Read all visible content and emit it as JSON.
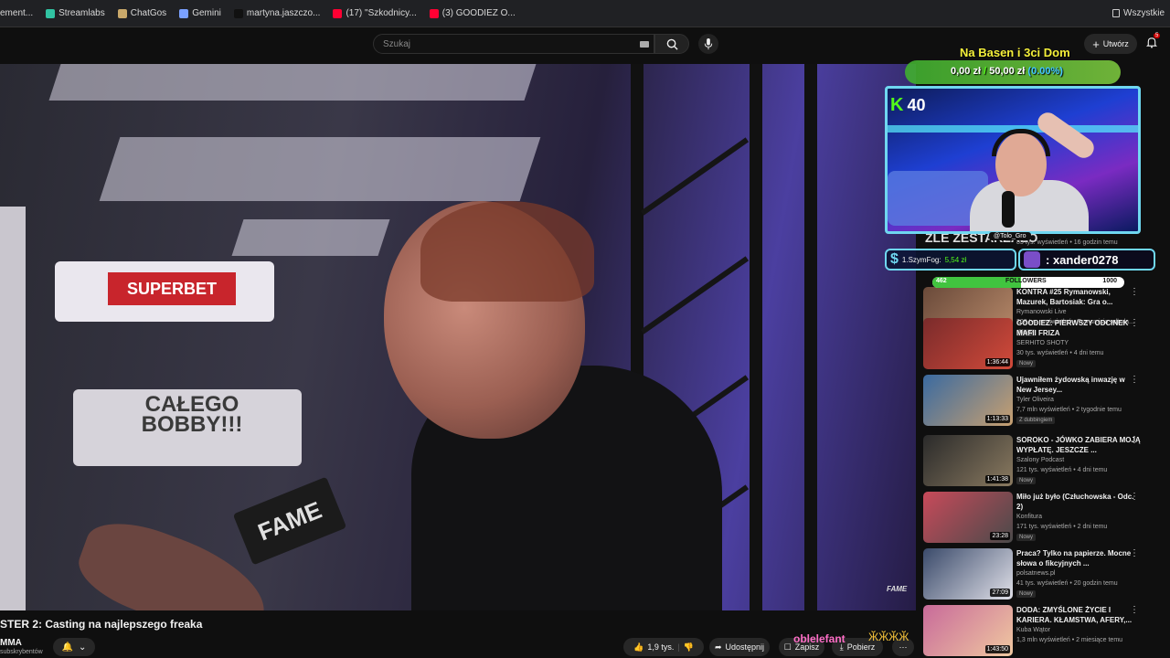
{
  "bookmarks": [
    {
      "label": "ement...",
      "color": "#888888"
    },
    {
      "label": "Streamlabs",
      "color": "#31c3a2"
    },
    {
      "label": "ChatGos",
      "color": "#c9a86a"
    },
    {
      "label": "Gemini",
      "color": "#7aa0ff"
    },
    {
      "label": "martyna.jaszczo...",
      "color": "#111111"
    },
    {
      "label": "(17) \"Szkodnicy...",
      "color": "#ff0033"
    },
    {
      "label": "(3) GOODIEZ O...",
      "color": "#ff0033"
    }
  ],
  "bookmarks_right": "Wszystkie",
  "search": {
    "placeholder": "Szukaj"
  },
  "create_label": "Utwórz",
  "bell_count": "5",
  "video": {
    "superbet": "SUPERBET",
    "bobby": "CAŁEGO BOBBY!!!",
    "mic": "FAME",
    "watermark": "FAME"
  },
  "title": "STER 2: Casting na najlepszego freaka",
  "channel": {
    "name": "MMA",
    "subs": "subskrybentów"
  },
  "actions": {
    "likes": "1,9 tys.",
    "share": "Udostępnij",
    "save": "Zapisz",
    "download": "Pobierz"
  },
  "overlay": {
    "goal_title": "Na Basen i 3ci Dom",
    "goal_current": "0,00 zł",
    "goal_target": "50,00 zł",
    "goal_pct": "(0.00%)",
    "viewers": "40",
    "handle": "@Tolo_Gro",
    "donor_name": "1.SzymFog:",
    "donor_amount": "5,54 zł",
    "follower": ": xander0278",
    "followers_current": "462",
    "followers_label": "FOLLOWERS",
    "followers_goal": "1000",
    "followers_fraction": 0.462,
    "chat_name": "oblelefant",
    "chat_emote": "ӁӁӁӁ"
  },
  "recommendations": [
    {
      "title": "ZLE ZESTARZAŁO",
      "channel": "",
      "meta": "85 tys. wyświetleń • 16 godzin temu",
      "badge": "",
      "duration": "",
      "colors": [
        "#3a2f5a",
        "#7a6a9a"
      ]
    },
    {
      "title": "KONTRA #25 Rymanowski, Mazurek, Bartosiak: Gra o...",
      "channel": "Rymanowski Live",
      "meta": "208 tys. wyświetleń • Transmisja odbyła...",
      "badge": "Nowy",
      "duration": "2:22:35",
      "colors": [
        "#6a4a3a",
        "#b88a6a"
      ]
    },
    {
      "title": "GOODIEZ: PIERWSZY ODCINEK MAFII FRIZA",
      "channel": "SERHITO SHOTY",
      "meta": "30 tys. wyświetleń • 4 dni temu",
      "badge": "Nowy",
      "duration": "1:36:44",
      "colors": [
        "#7a2b2b",
        "#d24a3a"
      ]
    },
    {
      "title": "Ujawniłem żydowską inwazję w New Jersey...",
      "channel": "Tyler Oliveira",
      "meta": "7,7 mln wyświetleń • 2 tygodnie temu",
      "badge": "Z dubbingiem",
      "duration": "1:13:33",
      "colors": [
        "#3a6aa0",
        "#c8a070"
      ]
    },
    {
      "title": "SOROKO - JÓWKO ZABIERA MOJĄ WYPŁATĘ. JESZCZE ...",
      "channel": "Szalony Podcast",
      "meta": "121 tys. wyświetleń • 4 dni temu",
      "badge": "Nowy",
      "duration": "1:41:38",
      "colors": [
        "#2a2a2a",
        "#8a7a60"
      ]
    },
    {
      "title": "Miło już było (Człuchowska - Odc. 2)",
      "channel": "Konfitura",
      "meta": "171 tys. wyświetleń • 2 dni temu",
      "badge": "Nowy",
      "duration": "23:28",
      "colors": [
        "#c84a5a",
        "#4a4a4a"
      ]
    },
    {
      "title": "Praca? Tylko na papierze. Mocne słowa o fikcyjnych ...",
      "channel": "polsatnews.pl",
      "meta": "41 tys. wyświetleń • 20 godzin temu",
      "badge": "Nowy",
      "duration": "27:09",
      "colors": [
        "#3a4a6a",
        "#e0e0e8"
      ]
    },
    {
      "title": "DODA: ZMYŚLONE ŻYCIE I KARIERA. KŁAMSTWA, AFERY,...",
      "channel": "Kuba Wątor",
      "meta": "1,3 mln wyświetleń • 2 miesiące temu",
      "badge": "",
      "duration": "1:43:50",
      "colors": [
        "#c86a9a",
        "#f0c8a0"
      ]
    }
  ]
}
